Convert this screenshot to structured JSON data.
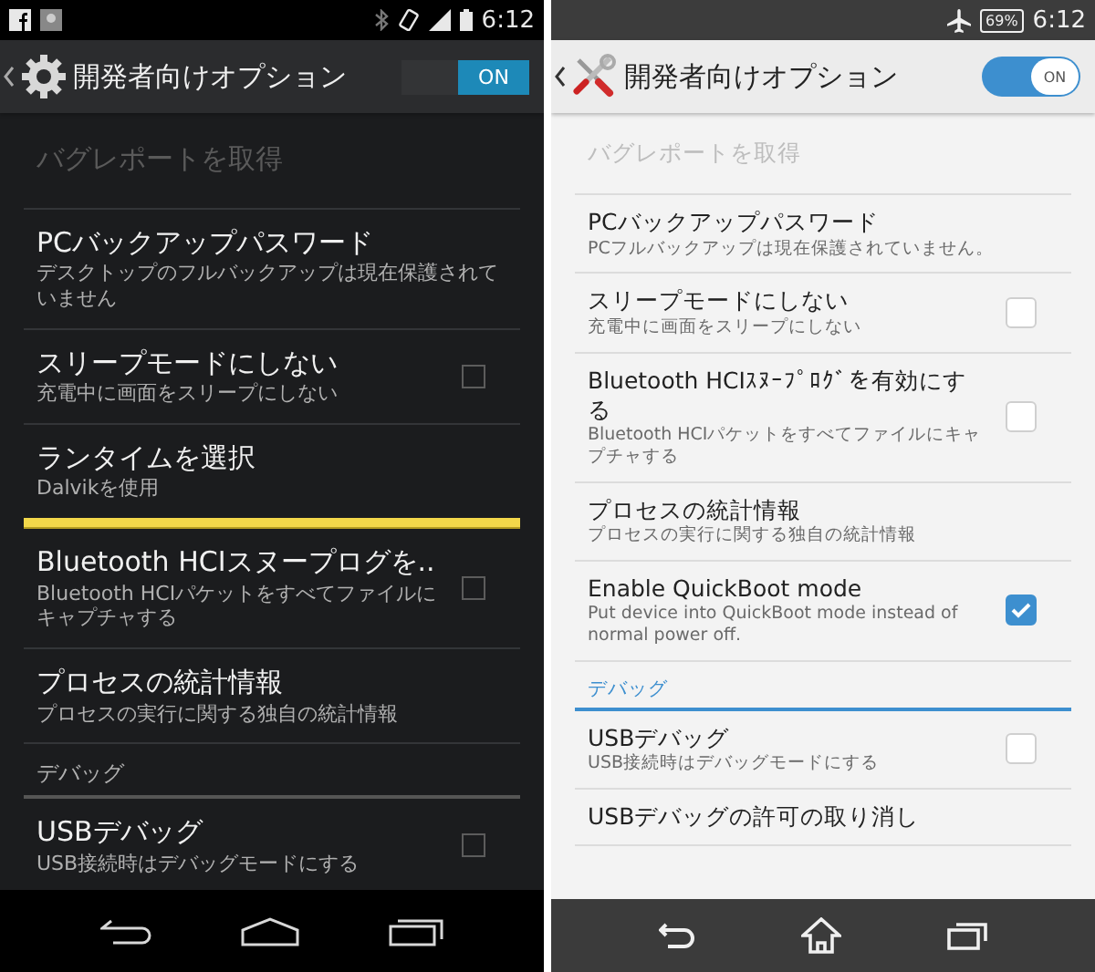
{
  "phones": [
    {
      "kind": "dark",
      "status_bar": {
        "time": "6:12"
      },
      "title": "開発者向けオプション",
      "switch": {
        "label": "ON",
        "on": true
      },
      "items": [
        {
          "kind": "action",
          "title": "バグレポートを取得",
          "disabled": true
        },
        {
          "kind": "plain",
          "title": "PCバックアップパスワード",
          "summary": "デスクトップのフルバックアップは現在保護されていません",
          "disabled": false
        },
        {
          "kind": "checkbox",
          "title": "スリープモードにしない",
          "summary": "充電中に画面をスリープにしない",
          "checked": false,
          "disabled": false
        },
        {
          "kind": "plain",
          "title": "ランタイムを選択",
          "summary": "Dalvikを使用",
          "highlighted": true,
          "disabled": false
        },
        {
          "kind": "checkbox",
          "title": "Bluetooth HCIスヌープログを..",
          "summary": "Bluetooth HCIパケットをすべてファイルにキャプチャする",
          "checked": false,
          "disabled": false
        },
        {
          "kind": "plain",
          "title": "プロセスの統計情報",
          "summary": "プロセスの実行に関する独自の統計情報",
          "disabled": false
        },
        {
          "kind": "category",
          "title": "デバッグ"
        },
        {
          "kind": "checkbox",
          "title": "USBデバッグ",
          "summary": "USB接続時はデバッグモードにする",
          "checked": false,
          "disabled": false
        }
      ]
    },
    {
      "kind": "light",
      "status_bar": {
        "time": "6:12",
        "battery": "69%"
      },
      "title": "開発者向けオプション",
      "switch": {
        "label": "ON",
        "on": true
      },
      "items": [
        {
          "kind": "action",
          "title": "バグレポートを取得",
          "disabled": true
        },
        {
          "kind": "plain",
          "title": "PCバックアップパスワード",
          "summary": "PCフルバックアップは現在保護されていません。",
          "disabled": false
        },
        {
          "kind": "checkbox",
          "title": "スリープモードにしない",
          "summary": "充電中に画面をスリープにしない",
          "checked": false,
          "disabled": false
        },
        {
          "kind": "checkbox",
          "title": "Bluetooth HCIｽﾇｰﾌﾟﾛｸﾞを有効にする",
          "summary": "Bluetooth HCIパケットをすべてファイルにキャプチャする",
          "checked": false,
          "disabled": false
        },
        {
          "kind": "plain",
          "title": "プロセスの統計情報",
          "summary": "プロセスの実行に関する独自の統計情報",
          "disabled": false
        },
        {
          "kind": "checkbox",
          "title": "Enable QuickBoot mode",
          "summary": "Put device into QuickBoot mode instead of normal power off.",
          "checked": true,
          "disabled": false
        },
        {
          "kind": "category",
          "title": "デバッグ"
        },
        {
          "kind": "checkbox",
          "title": "USBデバッグ",
          "summary": "USB接続時はデバッグモードにする",
          "checked": false,
          "disabled": false
        },
        {
          "kind": "plain",
          "title": "USBデバッグの許可の取り消し",
          "disabled": false
        }
      ]
    }
  ]
}
